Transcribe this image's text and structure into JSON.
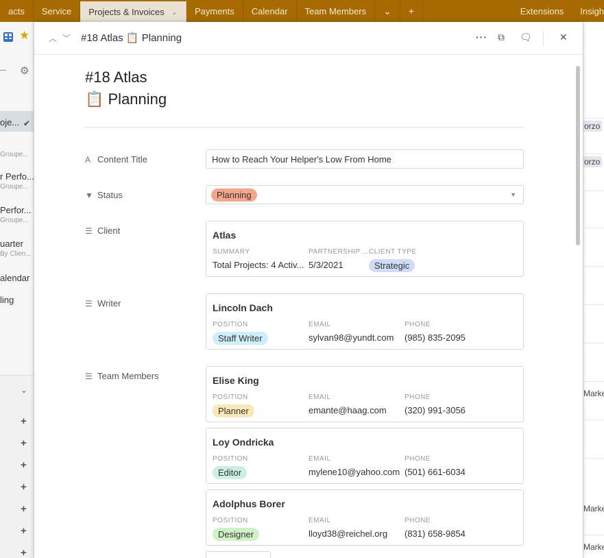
{
  "topbar": {
    "tabs": [
      {
        "label": "acts"
      },
      {
        "label": "Service"
      },
      {
        "label": "Projects & Invoices",
        "active": true
      },
      {
        "label": "Payments"
      },
      {
        "label": "Calendar"
      },
      {
        "label": "Team Members"
      }
    ],
    "more_icon": "chevron-down-icon",
    "add_icon": "plus-icon",
    "right_tabs": [
      "Extensions",
      "Insigh"
    ]
  },
  "sidebar": {
    "items": [
      {
        "label": "oje...",
        "sub": ""
      },
      {
        "label": "",
        "sub": "Groupe..."
      },
      {
        "label": "r Perfo...",
        "sub": "Groupe..."
      },
      {
        "label": "Perfor...",
        "sub": "Groupe..."
      },
      {
        "label": "uarter",
        "sub": "By Clien..."
      },
      {
        "label": "alendar",
        "sub": ""
      },
      {
        "label": "ling",
        "sub": ""
      }
    ]
  },
  "background_right": {
    "cells": [
      "orzo",
      "orzo",
      "Marke",
      "Marke",
      "Marke"
    ]
  },
  "modal": {
    "header_title": "#18 Atlas 📋 Planning",
    "title_line1": "#18 Atlas",
    "title_line2": "📋 Planning",
    "fields": {
      "content_title_label": "Content Title",
      "content_title_value": "How to Reach Your Helper's Low From Home",
      "status_label": "Status",
      "status_value": "Planning",
      "client_label": "Client",
      "writer_label": "Writer",
      "team_label": "Team Members"
    },
    "client": {
      "name": "Atlas",
      "summary_label": "SUMMARY",
      "summary_value": "Total Projects: 4 Activ...",
      "partnership_label": "PARTNERSHIP ...",
      "partnership_value": "5/3/2021",
      "type_label": "CLIENT TYPE",
      "type_value": "Strategic"
    },
    "writer": {
      "name": "Lincoln Dach",
      "position_label": "POSITION",
      "position": "Staff Writer",
      "email_label": "EMAIL",
      "email": "sylvan98@yundt.com",
      "phone_label": "PHONE",
      "phone": "(985) 835-2095"
    },
    "team": [
      {
        "name": "Elise King",
        "position_label": "POSITION",
        "position": "Planner",
        "email_label": "EMAIL",
        "email": "emante@haag.com",
        "phone_label": "PHONE",
        "phone": "(320) 991-3056"
      },
      {
        "name": "Loy Ondricka",
        "position_label": "POSITION",
        "position": "Editor",
        "email_label": "EMAIL",
        "email": "mylene10@yahoo.com",
        "phone_label": "PHONE",
        "phone": "(501) 661-6034"
      },
      {
        "name": "Adolphus Borer",
        "position_label": "POSITION",
        "position": "Designer",
        "email_label": "EMAIL",
        "email": "lloyd38@reichel.org",
        "phone_label": "PHONE",
        "phone": "(831) 658-9854"
      }
    ]
  },
  "colors": {
    "topbar": "#a66a00",
    "planning_pill": "#f4a58a",
    "strategic_pill": "#cfdcf8",
    "staff_writer_pill": "#cdeefa",
    "planner_pill": "#fbe8b8",
    "editor_pill": "#c8f1e4",
    "designer_pill": "#cdf2c4"
  }
}
